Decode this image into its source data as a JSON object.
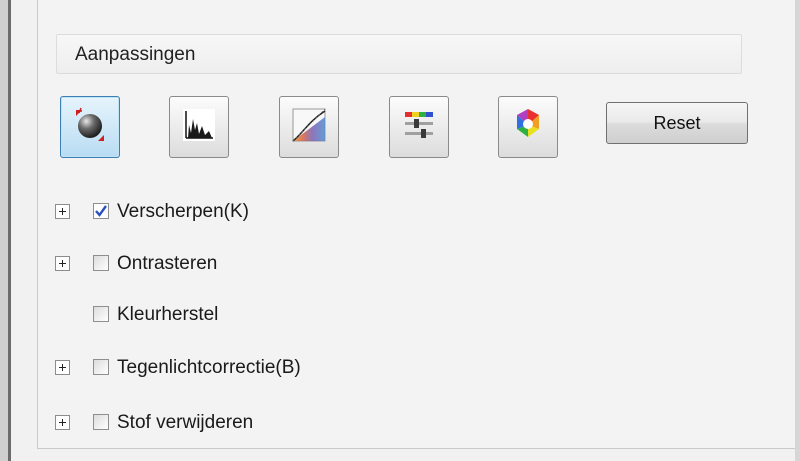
{
  "panel": {
    "group_title": "Aanpassingen"
  },
  "toolbar": {
    "tools": [
      {
        "name": "auto-adjust-icon",
        "active": true
      },
      {
        "name": "histogram-icon",
        "active": false
      },
      {
        "name": "tone-curve-icon",
        "active": false
      },
      {
        "name": "color-balance-icon",
        "active": false
      },
      {
        "name": "color-palette-icon",
        "active": false
      }
    ],
    "reset_label": "Reset"
  },
  "options": [
    {
      "label": "Verscherpen(K)",
      "checked": true,
      "expandable": true
    },
    {
      "label": "Ontrasteren",
      "checked": false,
      "expandable": true
    },
    {
      "label": "Kleurherstel",
      "checked": false,
      "expandable": false
    },
    {
      "label": "Tegenlichtcorrectie(B)",
      "checked": false,
      "expandable": true
    },
    {
      "label": "Stof verwijderen",
      "checked": false,
      "expandable": true
    }
  ],
  "colors": {
    "active_tool_border": "#3c7fb1",
    "checkmark": "#2a4fbf"
  }
}
